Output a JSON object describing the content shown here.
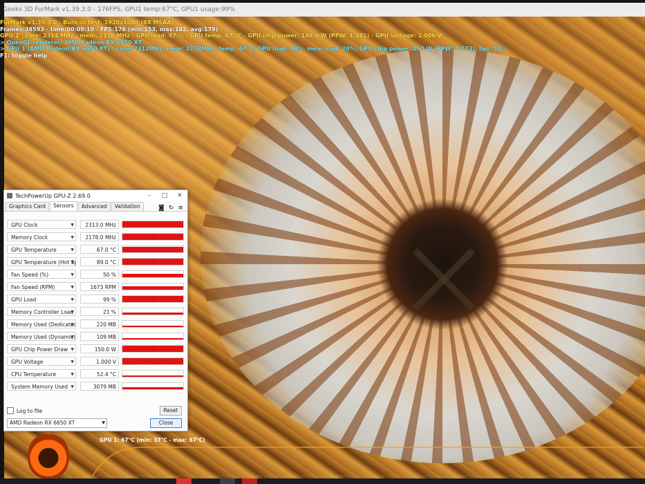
{
  "window": {
    "title": "Geeks 3D FurMark v1.39.3.0 - 176FPS, GPU1 temp:67°C, GPU1 usage:99%"
  },
  "osd": {
    "lines": [
      {
        "text": "FurMark v1.39.3.0 - Burn-in test, 1920x1080 (8X MSAA)",
        "color": "yellow"
      },
      {
        "text": "Frames:38593 - time:00:09:10 - FPS:176 (min:153, max:182, avg:179)",
        "color": "white"
      },
      {
        "text": "GPU-Z | core: 2314 MHz - mem: 2178 MHz - GPU load: 97 % - GPU temp: 67 °C - GPU chip power: 149.0 W (PPW: 1.181) - GPU voltage: 1.006 V",
        "color": "yellow"
      },
      {
        "text": "> OpenGL renderer: AMD Radeon RX 6650 XT",
        "color": "cyan"
      },
      {
        "text": "> GPU 1 (AMD Radeon RX 6650 XT) - core: 2312MHz, mem: 2178MHz, temp: 67°C, GPU load: 98%, mem load: 20%, GPU chip power: 150 W (PPW: 1.173), fan: 50%",
        "color": "cyan"
      },
      {
        "text": "F1: toggle help",
        "color": "white"
      }
    ]
  },
  "gpuz": {
    "title": "TechPowerUp GPU-Z 2.69.0",
    "tabs": [
      "Graphics Card",
      "Sensors",
      "Advanced",
      "Validation"
    ],
    "active_tab": "Sensors",
    "icons": [
      "camera-icon",
      "refresh-icon",
      "menu-icon"
    ],
    "sensors": [
      {
        "label": "GPU Clock",
        "value": "2313.0 MHz",
        "level": 0.98
      },
      {
        "label": "Memory Clock",
        "value": "2178.0 MHz",
        "level": 0.97
      },
      {
        "label": "GPU Temperature",
        "value": "67.0 °C",
        "level": 0.85
      },
      {
        "label": "GPU Temperature (Hot Spot)",
        "value": "89.0 °C",
        "level": 0.92
      },
      {
        "label": "Fan Speed (%)",
        "value": "50 %",
        "level": 0.5
      },
      {
        "label": "Fan Speed (RPM)",
        "value": "1673 RPM",
        "level": 0.55
      },
      {
        "label": "GPU Load",
        "value": "99 %",
        "level": 0.99
      },
      {
        "label": "Memory Controller Load",
        "value": "21 %",
        "level": 0.21
      },
      {
        "label": "Memory Used (Dedicated)",
        "value": "220 MB",
        "level": 0.03
      },
      {
        "label": "Memory Used (Dynamic)",
        "value": "109 MB",
        "level": 0.02
      },
      {
        "label": "GPU Chip Power Draw",
        "value": "150.0 W",
        "level": 0.96
      },
      {
        "label": "GPU Voltage",
        "value": "1.000 V",
        "level": 0.9
      },
      {
        "label": "CPU Temperature",
        "value": "52.4 °C",
        "level": 0.1
      },
      {
        "label": "System Memory Used",
        "value": "3079 MB",
        "level": 0.2
      }
    ],
    "log_to_file": "Log to file",
    "reset_label": "Reset",
    "device": "AMD Radeon RX 6650 XT",
    "close_label": "Close"
  },
  "graph": {
    "label": "GPU 1: 67°C (min: 37°C - max: 67°C)",
    "line_color": "#f0a020",
    "min_temp": 37,
    "max_temp": 67
  },
  "colors": {
    "accent_red": "#e81616",
    "osd_yellow": "#ffe23b",
    "osd_cyan": "#6fe6ff"
  }
}
